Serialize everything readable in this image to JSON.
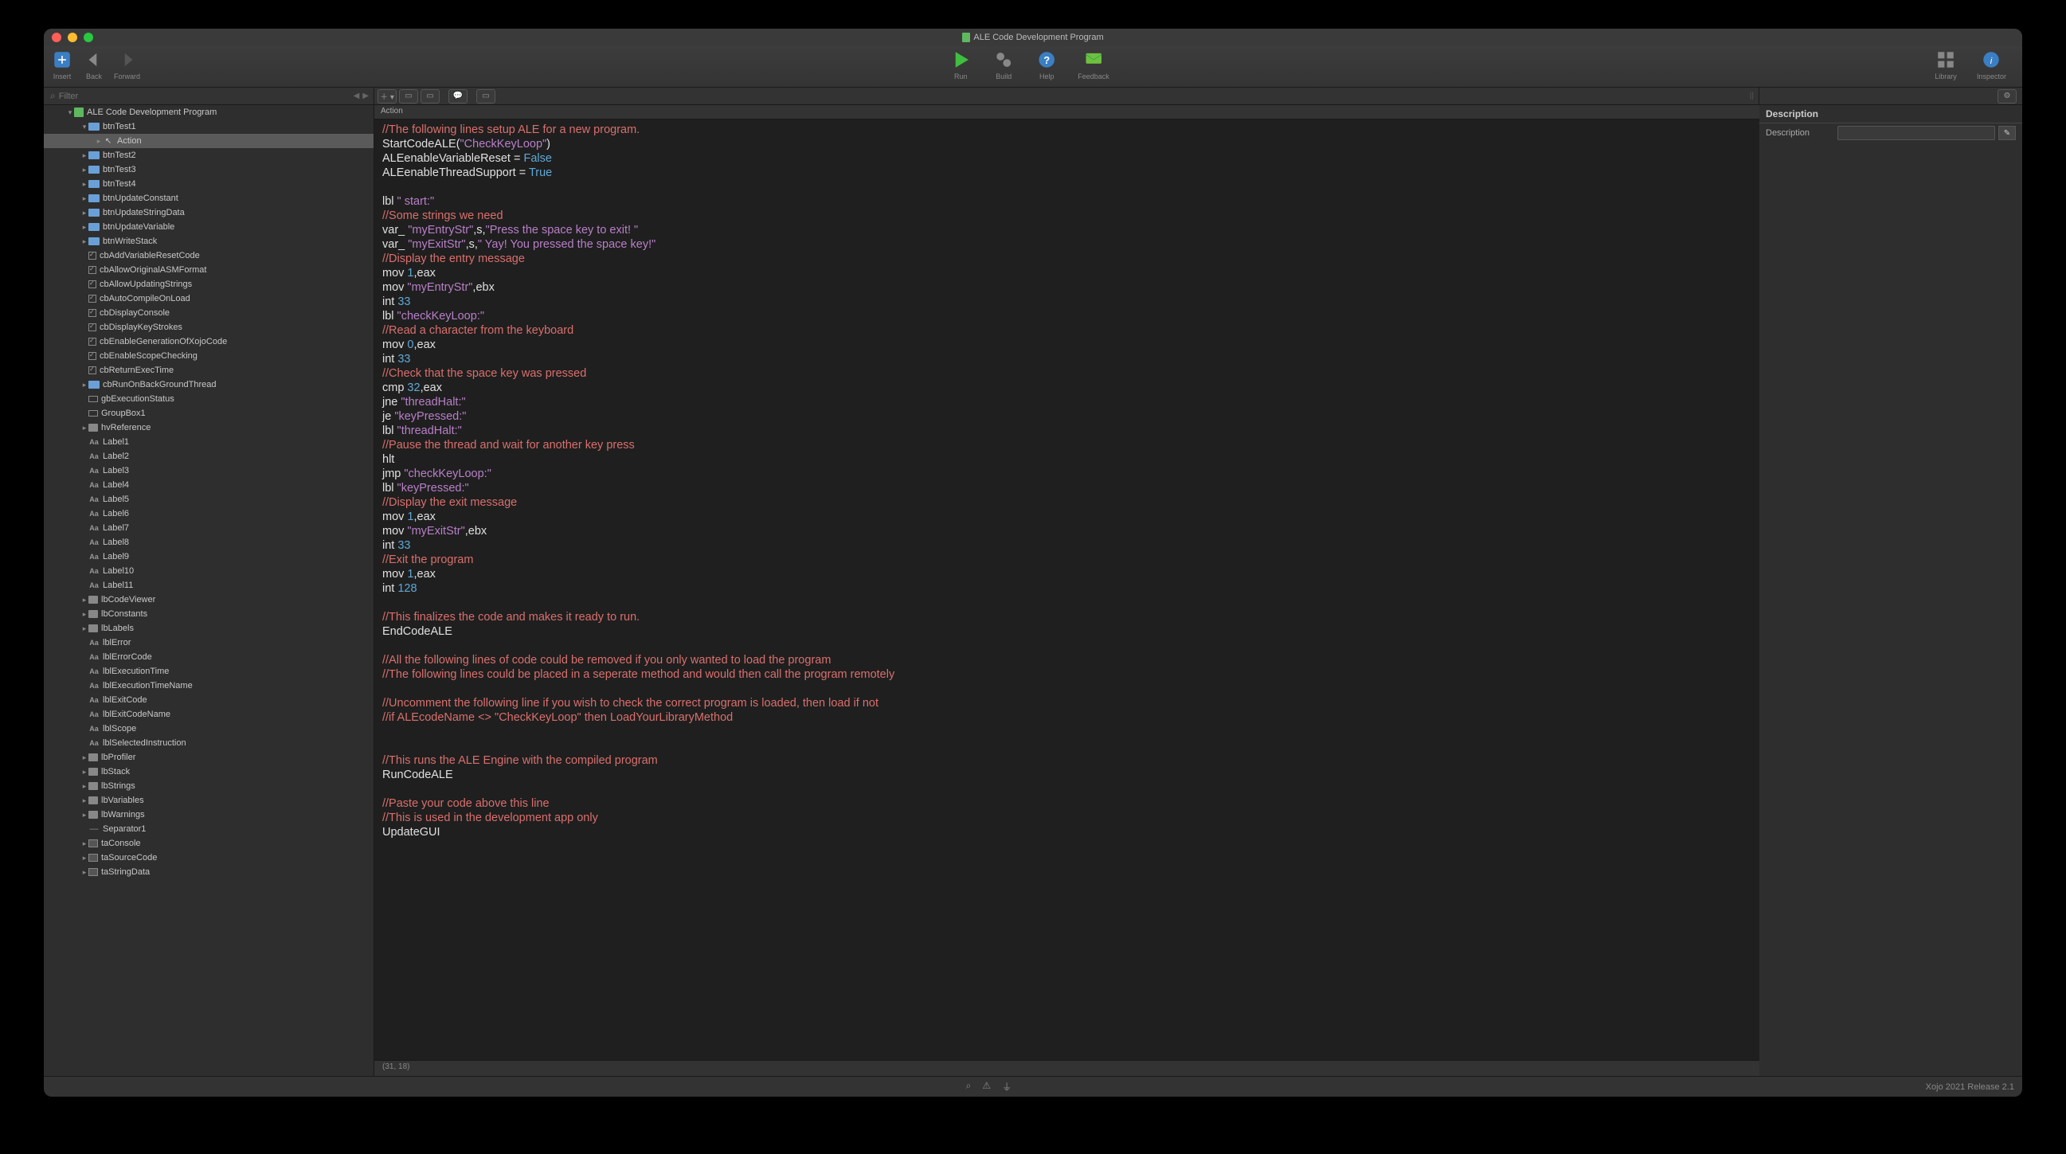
{
  "window": {
    "title": "ALE Code Development Program"
  },
  "toolbar": {
    "insert": "Insert",
    "back": "Back",
    "forward": "Forward",
    "run": "Run",
    "build": "Build",
    "help": "Help",
    "feedback": "Feedback",
    "library": "Library",
    "inspector": "Inspector"
  },
  "filter": {
    "placeholder": "Filter"
  },
  "nav": {
    "root": "ALE Code Development Program",
    "selected": "Action",
    "items": [
      {
        "d": 1,
        "exp": 1,
        "ic": "folder",
        "t": "btnTest1"
      },
      {
        "d": 2,
        "exp": 0,
        "ic": "cursor",
        "t": "Action",
        "sel": 1
      },
      {
        "d": 1,
        "exp": 0,
        "ic": "folder",
        "t": "btnTest2"
      },
      {
        "d": 1,
        "exp": 0,
        "ic": "folder",
        "t": "btnTest3"
      },
      {
        "d": 1,
        "exp": 0,
        "ic": "folder",
        "t": "btnTest4"
      },
      {
        "d": 1,
        "exp": 0,
        "ic": "folder",
        "t": "btnUpdateConstant"
      },
      {
        "d": 1,
        "exp": 0,
        "ic": "folder",
        "t": "btnUpdateStringData"
      },
      {
        "d": 1,
        "exp": 0,
        "ic": "folder",
        "t": "btnUpdateVariable"
      },
      {
        "d": 1,
        "exp": 0,
        "ic": "folder",
        "t": "btnWriteStack"
      },
      {
        "d": 1,
        "leaf": 1,
        "ic": "cb",
        "t": "cbAddVariableResetCode"
      },
      {
        "d": 1,
        "leaf": 1,
        "ic": "cb",
        "t": "cbAllowOriginalASMFormat"
      },
      {
        "d": 1,
        "leaf": 1,
        "ic": "cb",
        "t": "cbAllowUpdatingStrings"
      },
      {
        "d": 1,
        "leaf": 1,
        "ic": "cb",
        "t": "cbAutoCompileOnLoad"
      },
      {
        "d": 1,
        "leaf": 1,
        "ic": "cb",
        "t": "cbDisplayConsole"
      },
      {
        "d": 1,
        "leaf": 1,
        "ic": "cb",
        "t": "cbDisplayKeyStrokes"
      },
      {
        "d": 1,
        "leaf": 1,
        "ic": "cb",
        "t": "cbEnableGenerationOfXojoCode"
      },
      {
        "d": 1,
        "leaf": 1,
        "ic": "cb",
        "t": "cbEnableScopeChecking"
      },
      {
        "d": 1,
        "leaf": 1,
        "ic": "cb",
        "t": "cbReturnExecTime"
      },
      {
        "d": 1,
        "exp": 0,
        "ic": "folder",
        "t": "cbRunOnBackGroundThread"
      },
      {
        "d": 1,
        "leaf": 1,
        "ic": "gb",
        "t": "gbExecutionStatus"
      },
      {
        "d": 1,
        "leaf": 1,
        "ic": "gb",
        "t": "GroupBox1"
      },
      {
        "d": 1,
        "exp": 0,
        "ic": "gray",
        "t": "hvReference"
      },
      {
        "d": 1,
        "leaf": 1,
        "ic": "aa",
        "t": "Label1"
      },
      {
        "d": 1,
        "leaf": 1,
        "ic": "aa",
        "t": "Label2"
      },
      {
        "d": 1,
        "leaf": 1,
        "ic": "aa",
        "t": "Label3"
      },
      {
        "d": 1,
        "leaf": 1,
        "ic": "aa",
        "t": "Label4"
      },
      {
        "d": 1,
        "leaf": 1,
        "ic": "aa",
        "t": "Label5"
      },
      {
        "d": 1,
        "leaf": 1,
        "ic": "aa",
        "t": "Label6"
      },
      {
        "d": 1,
        "leaf": 1,
        "ic": "aa",
        "t": "Label7"
      },
      {
        "d": 1,
        "leaf": 1,
        "ic": "aa",
        "t": "Label8"
      },
      {
        "d": 1,
        "leaf": 1,
        "ic": "aa",
        "t": "Label9"
      },
      {
        "d": 1,
        "leaf": 1,
        "ic": "aa",
        "t": "Label10"
      },
      {
        "d": 1,
        "leaf": 1,
        "ic": "aa",
        "t": "Label11"
      },
      {
        "d": 1,
        "exp": 0,
        "ic": "gray",
        "t": "lbCodeViewer"
      },
      {
        "d": 1,
        "exp": 0,
        "ic": "gray",
        "t": "lbConstants"
      },
      {
        "d": 1,
        "exp": 0,
        "ic": "gray",
        "t": "lbLabels"
      },
      {
        "d": 1,
        "leaf": 1,
        "ic": "aa",
        "t": "lblError"
      },
      {
        "d": 1,
        "leaf": 1,
        "ic": "aa",
        "t": "lblErrorCode"
      },
      {
        "d": 1,
        "leaf": 1,
        "ic": "aa",
        "t": "lblExecutionTime"
      },
      {
        "d": 1,
        "leaf": 1,
        "ic": "aa",
        "t": "lblExecutionTimeName"
      },
      {
        "d": 1,
        "leaf": 1,
        "ic": "aa",
        "t": "lblExitCode"
      },
      {
        "d": 1,
        "leaf": 1,
        "ic": "aa",
        "t": "lblExitCodeName"
      },
      {
        "d": 1,
        "leaf": 1,
        "ic": "aa",
        "t": "lblScope"
      },
      {
        "d": 1,
        "leaf": 1,
        "ic": "aa",
        "t": "lblSelectedInstruction"
      },
      {
        "d": 1,
        "exp": 0,
        "ic": "gray",
        "t": "lbProfiler"
      },
      {
        "d": 1,
        "exp": 0,
        "ic": "gray",
        "t": "lbStack"
      },
      {
        "d": 1,
        "exp": 0,
        "ic": "gray",
        "t": "lbStrings"
      },
      {
        "d": 1,
        "exp": 0,
        "ic": "gray",
        "t": "lbVariables"
      },
      {
        "d": 1,
        "exp": 0,
        "ic": "gray",
        "t": "lbWarnings"
      },
      {
        "d": 1,
        "leaf": 1,
        "ic": "sep",
        "t": "Separator1"
      },
      {
        "d": 1,
        "exp": 0,
        "ic": "ta",
        "t": "taConsole"
      },
      {
        "d": 1,
        "exp": 0,
        "ic": "ta",
        "t": "taSourceCode"
      },
      {
        "d": 1,
        "exp": 0,
        "ic": "ta",
        "t": "taStringData"
      }
    ]
  },
  "breadcrumb": "Action",
  "code": [
    [
      [
        "c",
        "//The following lines setup ALE for a new program."
      ]
    ],
    [
      [
        "w",
        "StartCodeALE("
      ],
      [
        "s",
        "\"CheckKeyLoop\""
      ],
      [
        "w",
        ")"
      ]
    ],
    [
      [
        "w",
        "ALEenableVariableReset = "
      ],
      [
        "b",
        "False"
      ]
    ],
    [
      [
        "w",
        "ALEenableThreadSupport = "
      ],
      [
        "b",
        "True"
      ]
    ],
    [
      [
        "w",
        ""
      ]
    ],
    [
      [
        "w",
        "lbl "
      ],
      [
        "s",
        "\" start:\""
      ]
    ],
    [
      [
        "c",
        "//Some strings we need"
      ]
    ],
    [
      [
        "w",
        "var_ "
      ],
      [
        "s",
        "\"myEntryStr\""
      ],
      [
        "w",
        ",s,"
      ],
      [
        "s",
        "\"Press the space key to exit! \""
      ]
    ],
    [
      [
        "w",
        "var_ "
      ],
      [
        "s",
        "\"myExitStr\""
      ],
      [
        "w",
        ",s,"
      ],
      [
        "s",
        "\" Yay! You pressed the space key!\""
      ]
    ],
    [
      [
        "c",
        "//Display the entry message"
      ]
    ],
    [
      [
        "w",
        "mov "
      ],
      [
        "n",
        "1"
      ],
      [
        "w",
        ",eax"
      ]
    ],
    [
      [
        "w",
        "mov "
      ],
      [
        "s",
        "\"myEntryStr\""
      ],
      [
        "w",
        ",ebx"
      ]
    ],
    [
      [
        "w",
        "int "
      ],
      [
        "n",
        "33"
      ]
    ],
    [
      [
        "w",
        "lbl "
      ],
      [
        "s",
        "\"checkKeyLoop:\""
      ]
    ],
    [
      [
        "c",
        "//Read a character from the keyboard"
      ]
    ],
    [
      [
        "w",
        "mov "
      ],
      [
        "n",
        "0"
      ],
      [
        "w",
        ",eax"
      ]
    ],
    [
      [
        "w",
        "int "
      ],
      [
        "n",
        "33"
      ]
    ],
    [
      [
        "c",
        "//Check that the space key was pressed"
      ]
    ],
    [
      [
        "w",
        "cmp "
      ],
      [
        "n",
        "32"
      ],
      [
        "w",
        ",eax"
      ]
    ],
    [
      [
        "w",
        "jne "
      ],
      [
        "s",
        "\"threadHalt:\""
      ]
    ],
    [
      [
        "w",
        "je "
      ],
      [
        "s",
        "\"keyPressed:\""
      ]
    ],
    [
      [
        "w",
        "lbl "
      ],
      [
        "s",
        "\"threadHalt:\""
      ]
    ],
    [
      [
        "c",
        "//Pause the thread and wait for another key press"
      ]
    ],
    [
      [
        "w",
        "hlt"
      ]
    ],
    [
      [
        "w",
        "jmp "
      ],
      [
        "s",
        "\"checkKeyLoop:\""
      ]
    ],
    [
      [
        "w",
        "lbl "
      ],
      [
        "s",
        "\"keyPressed:\""
      ]
    ],
    [
      [
        "c",
        "//Display the exit message"
      ]
    ],
    [
      [
        "w",
        "mov "
      ],
      [
        "n",
        "1"
      ],
      [
        "w",
        ",eax"
      ]
    ],
    [
      [
        "w",
        "mov "
      ],
      [
        "s",
        "\"myExitStr\""
      ],
      [
        "w",
        ",ebx"
      ]
    ],
    [
      [
        "w",
        "int "
      ],
      [
        "n",
        "33"
      ]
    ],
    [
      [
        "c",
        "//Exit the program"
      ]
    ],
    [
      [
        "w",
        "mov "
      ],
      [
        "n",
        "1"
      ],
      [
        "w",
        ",eax"
      ]
    ],
    [
      [
        "w",
        "int "
      ],
      [
        "n",
        "128"
      ]
    ],
    [
      [
        "w",
        ""
      ]
    ],
    [
      [
        "c",
        "//This finalizes the code and makes it ready to run."
      ]
    ],
    [
      [
        "w",
        "EndCodeALE"
      ]
    ],
    [
      [
        "w",
        ""
      ]
    ],
    [
      [
        "c",
        "//All the following lines of code could be removed if you only wanted to load the program"
      ]
    ],
    [
      [
        "c",
        "//The following lines could be placed in a seperate method and would then call the program remotely"
      ]
    ],
    [
      [
        "w",
        ""
      ]
    ],
    [
      [
        "c",
        "//Uncomment the following line if you wish to check the correct program is loaded, then load if not"
      ]
    ],
    [
      [
        "c",
        "//if ALEcodeName <> \"CheckKeyLoop\" then LoadYourLibraryMethod"
      ]
    ],
    [
      [
        "w",
        ""
      ]
    ],
    [
      [
        "w",
        ""
      ]
    ],
    [
      [
        "c",
        "//This runs the ALE Engine with the compiled program"
      ]
    ],
    [
      [
        "w",
        "RunCodeALE"
      ]
    ],
    [
      [
        "w",
        ""
      ]
    ],
    [
      [
        "c",
        "//Paste your code above this line"
      ]
    ],
    [
      [
        "c",
        "//This is used in the development app only"
      ]
    ],
    [
      [
        "w",
        "UpdateGUI"
      ]
    ]
  ],
  "status": "(31, 18)",
  "inspector": {
    "section": "Description",
    "label": "Description"
  },
  "footer": {
    "version": "Xojo 2021 Release 2.1"
  }
}
